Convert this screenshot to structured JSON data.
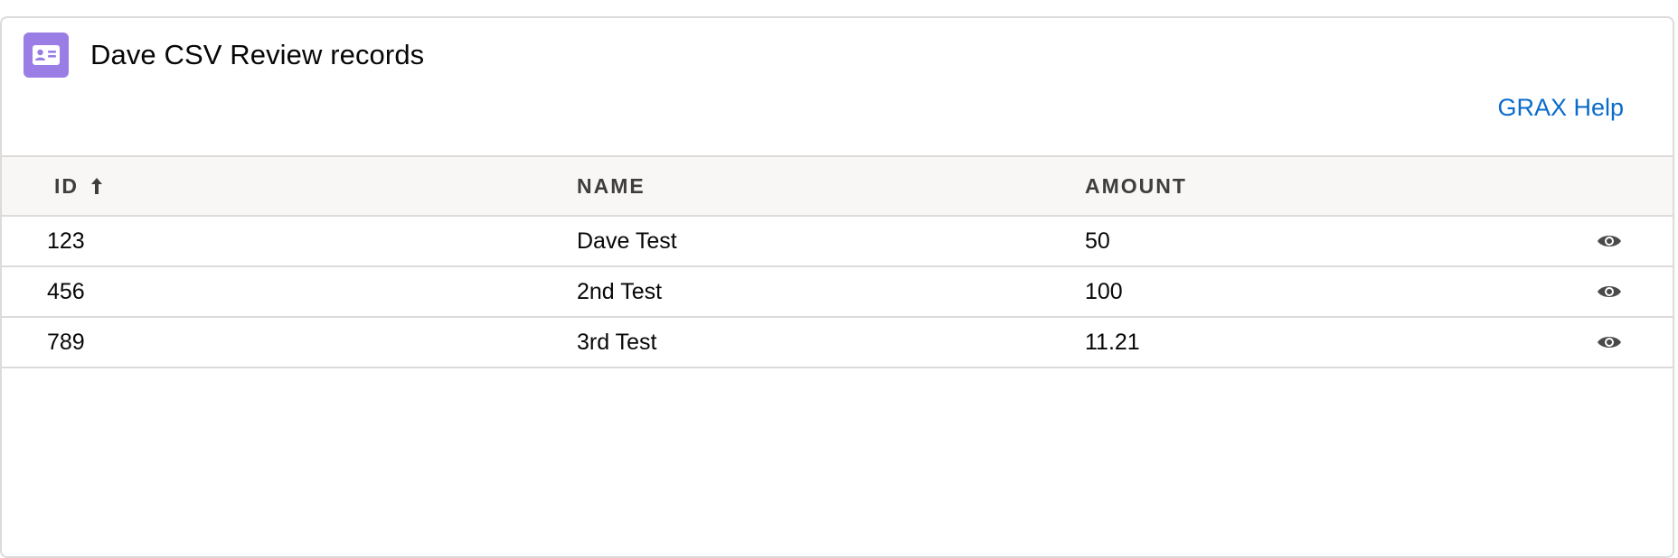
{
  "card": {
    "title": "Dave CSV Review records",
    "icon": "contact-card-icon",
    "help_link": "GRAX Help"
  },
  "table": {
    "columns": [
      {
        "label": "ID",
        "sorted": "ascending"
      },
      {
        "label": "NAME"
      },
      {
        "label": "AMOUNT"
      }
    ],
    "rows": [
      {
        "id": "123",
        "name": "Dave Test",
        "amount": "50"
      },
      {
        "id": "456",
        "name": "2nd Test",
        "amount": "100"
      },
      {
        "id": "789",
        "name": "3rd Test",
        "amount": "11.21"
      }
    ],
    "row_action_icon": "eye-icon"
  },
  "colors": {
    "icon_bg": "#9a7ee5",
    "link": "#0b6bcb",
    "header_bg": "#f8f7f5",
    "border": "#dddbda"
  }
}
